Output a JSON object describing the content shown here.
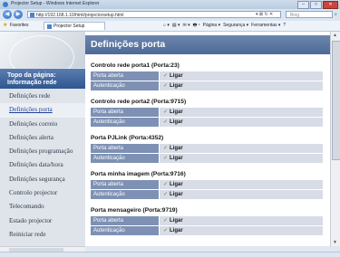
{
  "window": {
    "title": "Projector Setup - Windows Internet Explorer"
  },
  "toolbar": {
    "back": "◀",
    "forward": "▶",
    "address": "http://192.168.1.10/html/projectorsetup.html",
    "search_placeholder": "Bing",
    "tools": "▾ ⊠ ↻ ✕"
  },
  "favorites": {
    "label": "Favorites",
    "tab": "Projector Setup"
  },
  "commands": [
    "⌂ ▾",
    "▤ ▾",
    "✉ ▾",
    "🖶 ▾",
    "Página ▾",
    "Segurança ▾",
    "Ferramentas ▾",
    "?"
  ],
  "sidebar": {
    "header": "Topo da página: Informação rede",
    "items": [
      {
        "label": "Definições rede",
        "active": false
      },
      {
        "label": "Definições porta",
        "active": true
      },
      {
        "label": "Definições correio",
        "active": false
      },
      {
        "label": "Definições alerta",
        "active": false
      },
      {
        "label": "Definições programação",
        "active": false
      },
      {
        "label": "Definições data/hora",
        "active": false
      },
      {
        "label": "Definições segurança",
        "active": false
      },
      {
        "label": "Controlo projector",
        "active": false
      },
      {
        "label": "Telecomando",
        "active": false
      },
      {
        "label": "Estado projector",
        "active": false
      },
      {
        "label": "Reiniciar rede",
        "active": false
      }
    ]
  },
  "main": {
    "title": "Definições porta",
    "sections": [
      {
        "title": "Controlo rede porta1 (Porta:23)",
        "rows": [
          {
            "label": "Porta aberta",
            "value": "Ligar"
          },
          {
            "label": "Autenticação",
            "value": "Ligar"
          }
        ]
      },
      {
        "title": "Controlo rede porta2 (Porta:9715)",
        "rows": [
          {
            "label": "Porta aberta",
            "value": "Ligar"
          },
          {
            "label": "Autenticação",
            "value": "Ligar"
          }
        ]
      },
      {
        "title": "Porta PJLink (Porta:4352)",
        "rows": [
          {
            "label": "Porta aberta",
            "value": "Ligar"
          },
          {
            "label": "Autenticação",
            "value": "Ligar"
          }
        ]
      },
      {
        "title": "Porta minha imagem (Porta:9716)",
        "rows": [
          {
            "label": "Porta aberta",
            "value": "Ligar"
          },
          {
            "label": "Autenticação",
            "value": "Ligar"
          }
        ]
      },
      {
        "title": "Porta mensageiro (Porta:9719)",
        "rows": [
          {
            "label": "Porta aberta",
            "value": "Ligar"
          },
          {
            "label": "Autenticação",
            "value": "Ligar"
          }
        ]
      }
    ]
  },
  "colors": {
    "header": "#4d6a97",
    "label_cell": "#7e91b4",
    "value_cell": "#d7dce6",
    "active_link": "#1d3f9a"
  }
}
